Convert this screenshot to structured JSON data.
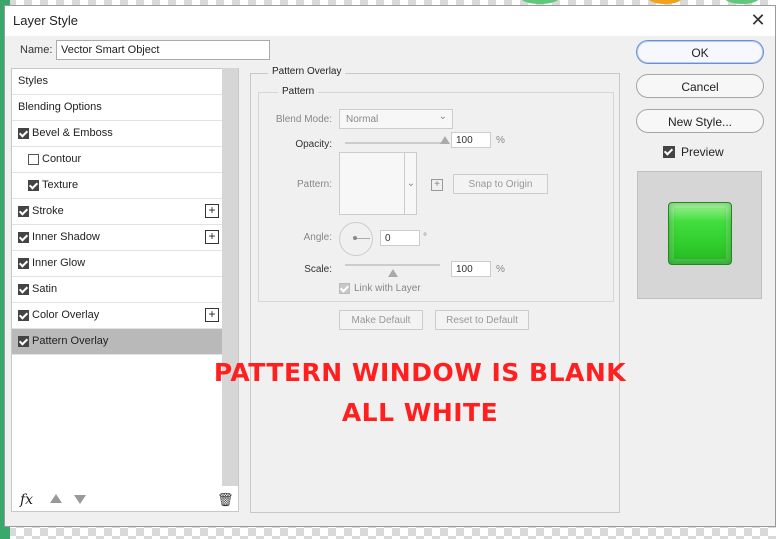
{
  "window": {
    "title": "Layer Style",
    "close_glyph": "✕"
  },
  "name_field": {
    "label": "Name:",
    "value": "Vector Smart Object"
  },
  "styles_list": [
    {
      "label": "Styles",
      "checkbox": false,
      "checked": false,
      "plus": false,
      "indent": false,
      "selected": false
    },
    {
      "label": "Blending Options",
      "checkbox": false,
      "checked": false,
      "plus": false,
      "indent": false,
      "selected": false
    },
    {
      "label": "Bevel & Emboss",
      "checkbox": true,
      "checked": true,
      "plus": false,
      "indent": false,
      "selected": false
    },
    {
      "label": "Contour",
      "checkbox": true,
      "checked": false,
      "plus": false,
      "indent": true,
      "selected": false
    },
    {
      "label": "Texture",
      "checkbox": true,
      "checked": true,
      "plus": false,
      "indent": true,
      "selected": false
    },
    {
      "label": "Stroke",
      "checkbox": true,
      "checked": true,
      "plus": true,
      "indent": false,
      "selected": false
    },
    {
      "label": "Inner Shadow",
      "checkbox": true,
      "checked": true,
      "plus": true,
      "indent": false,
      "selected": false
    },
    {
      "label": "Inner Glow",
      "checkbox": true,
      "checked": true,
      "plus": false,
      "indent": false,
      "selected": false
    },
    {
      "label": "Satin",
      "checkbox": true,
      "checked": true,
      "plus": false,
      "indent": false,
      "selected": false
    },
    {
      "label": "Color Overlay",
      "checkbox": true,
      "checked": true,
      "plus": true,
      "indent": false,
      "selected": false
    },
    {
      "label": "Pattern Overlay",
      "checkbox": true,
      "checked": true,
      "plus": false,
      "indent": false,
      "selected": true
    }
  ],
  "bottom_bar": {
    "fx_label": "fx",
    "icons": [
      "move-up-icon",
      "move-down-icon",
      "trash-icon"
    ],
    "trash_glyph": "🗑"
  },
  "pattern_overlay": {
    "group_title": "Pattern Overlay",
    "sub_title": "Pattern",
    "blend_mode": {
      "label": "Blend Mode:",
      "value": "Normal"
    },
    "opacity": {
      "label": "Opacity:",
      "value": "100",
      "unit": "%",
      "level": 1.0
    },
    "pattern": {
      "label": "Pattern:",
      "snap_button": "Snap to Origin",
      "plus_glyph": "+"
    },
    "angle": {
      "label": "Angle:",
      "value": "0",
      "unit": "°"
    },
    "scale": {
      "label": "Scale:",
      "value": "100",
      "unit": "%",
      "level": 0.5
    },
    "link_with_layer": {
      "label": "Link with Layer",
      "checked": true
    },
    "make_default": "Make Default",
    "reset_to_default": "Reset to Default"
  },
  "actions": {
    "ok": "OK",
    "cancel": "Cancel",
    "new_style": "New Style...",
    "preview_label": "Preview",
    "preview_checked": true
  },
  "annotation": {
    "line1": "PATTERN WINDOW IS BLANK",
    "line2": "ALL WHITE",
    "color": "#ff1f1f"
  },
  "colors": {
    "preview_swatch": "#35d232",
    "selected_row": "#b9b9b9",
    "ok_border": "#6a8fd8"
  }
}
